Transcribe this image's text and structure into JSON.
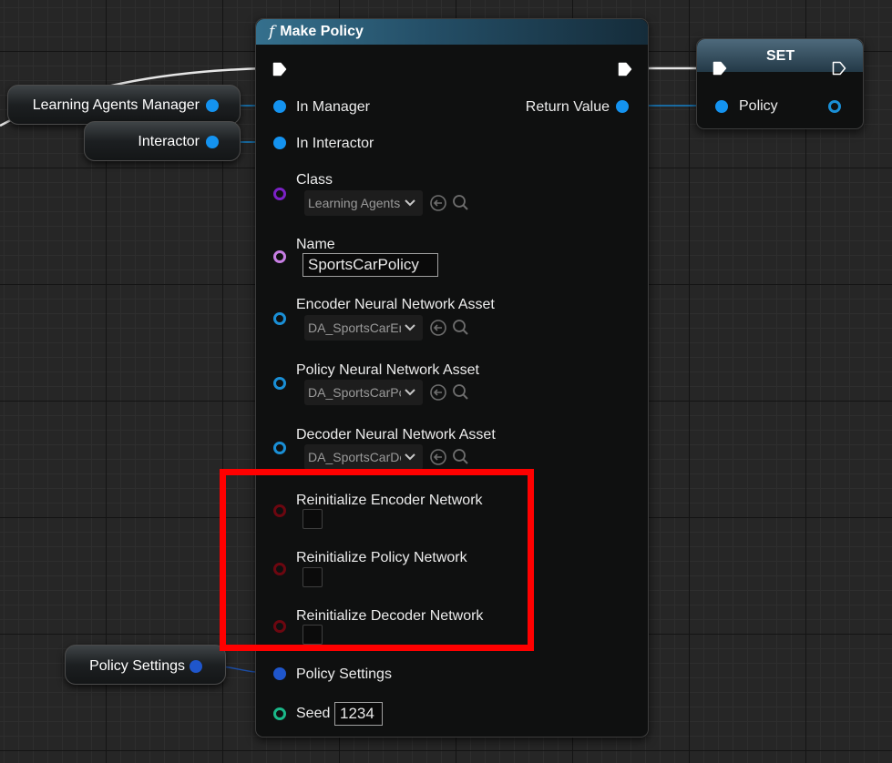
{
  "make_policy_node": {
    "title": "Make Policy",
    "func_icon": "f",
    "inputs": {
      "in_manager": "In Manager",
      "in_interactor": "In Interactor",
      "class": {
        "label": "Class",
        "value": "Learning Agents Policy"
      },
      "name": {
        "label": "Name",
        "value": "SportsCarPolicy"
      },
      "encoder_asset": {
        "label": "Encoder Neural Network Asset",
        "value": "DA_SportsCarEncoder"
      },
      "policy_asset": {
        "label": "Policy Neural Network Asset",
        "value": "DA_SportsCarPolicy"
      },
      "decoder_asset": {
        "label": "Decoder Neural Network Asset",
        "value": "DA_SportsCarDecoder"
      },
      "reinit_encoder": {
        "label": "Reinitialize Encoder Network",
        "checked": false
      },
      "reinit_policy": {
        "label": "Reinitialize Policy Network",
        "checked": false
      },
      "reinit_decoder": {
        "label": "Reinitialize Decoder Network",
        "checked": false
      },
      "policy_settings": "Policy Settings",
      "seed": {
        "label": "Seed",
        "value": "1234"
      }
    },
    "outputs": {
      "return_value": "Return Value"
    }
  },
  "set_node": {
    "title": "SET",
    "policy_pin": "Policy"
  },
  "variables": {
    "learning_agents_manager": "Learning Agents Manager",
    "interactor": "Interactor",
    "policy_settings": "Policy Settings"
  },
  "colors": {
    "object_pin": "#1493f0",
    "struct_pin": "#1f56cc",
    "class_pin": "#7b21c6",
    "name_pin": "#c77ee3",
    "bool_pin": "#6c0710",
    "int_pin": "#1ab889",
    "highlight": "#ff0000"
  },
  "icons": {
    "exec": "exec-arrow-icon",
    "combo": "chevron-down-icon",
    "use_selected": "arrow-left-circle-icon",
    "browse": "search-icon"
  }
}
